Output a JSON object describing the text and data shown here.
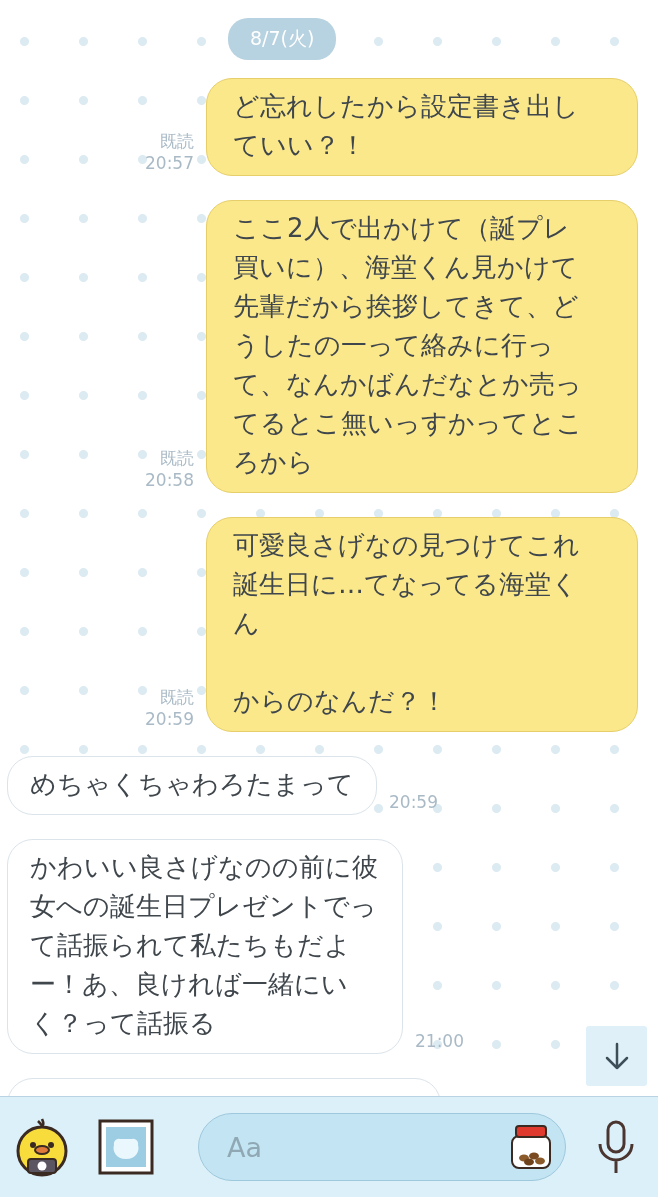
{
  "date_label": "8/7(火)",
  "messages": [
    {
      "kind": "sent",
      "paragraphs": [
        "ど忘れしたから設定書き出していい？！"
      ],
      "read_label": "既読",
      "time": "20:57"
    },
    {
      "kind": "sent",
      "paragraphs": [
        "ここ2人で出かけて（誕プレ買いに）、海堂くん見かけて先輩だから挨拶してきて、どうしたの一って絡みに行って、なんかばんだなとか売ってるとこ無いっすかってところから"
      ],
      "read_label": "既読",
      "time": "20:58"
    },
    {
      "kind": "sent",
      "paragraphs": [
        "可愛良さげなの見つけてこれ誕生日に…てなってる海堂くん",
        "からのなんだ？！"
      ],
      "read_label": "既読",
      "time": "20:59"
    },
    {
      "kind": "received",
      "paragraphs": [
        "めちゃくちゃわろたまって"
      ],
      "time": "20:59"
    },
    {
      "kind": "received",
      "paragraphs": [
        "かわいい良さげなのの前に彼女への誕生日プレゼントでって話振られて私たちもだよー！あ、良ければ一緒にいく？って話振る"
      ],
      "time": "21:00"
    },
    {
      "kind": "received_clipped"
    }
  ],
  "input": {
    "placeholder": "Aa"
  }
}
